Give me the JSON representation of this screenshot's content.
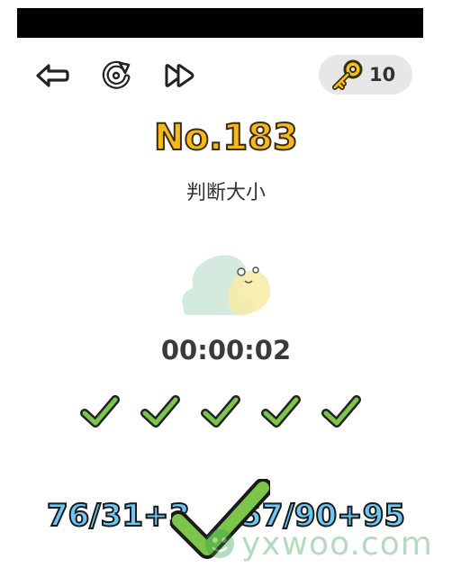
{
  "hint": {
    "count": "10",
    "icon": "key-icon"
  },
  "toolbar": {
    "back_icon": "back-arrow-icon",
    "restart_icon": "restart-icon",
    "skip_icon": "fast-forward-icon"
  },
  "level": {
    "number": "No.183",
    "title": "判断大小"
  },
  "timer": "00:00:02",
  "progress": {
    "completed": 5,
    "total": 5,
    "mark_icon": "checkmark-icon"
  },
  "question": {
    "left_expression": "76/31+3",
    "right_expression": "57/90+95",
    "result_icon": "big-checkmark-icon"
  },
  "watermark": {
    "text": "yxwoo.com"
  },
  "colors": {
    "level_number": "#f5b91f",
    "check_green": "#7dc44a",
    "question_text": "#6ec8f5",
    "watermark": "#2f9a4a"
  }
}
